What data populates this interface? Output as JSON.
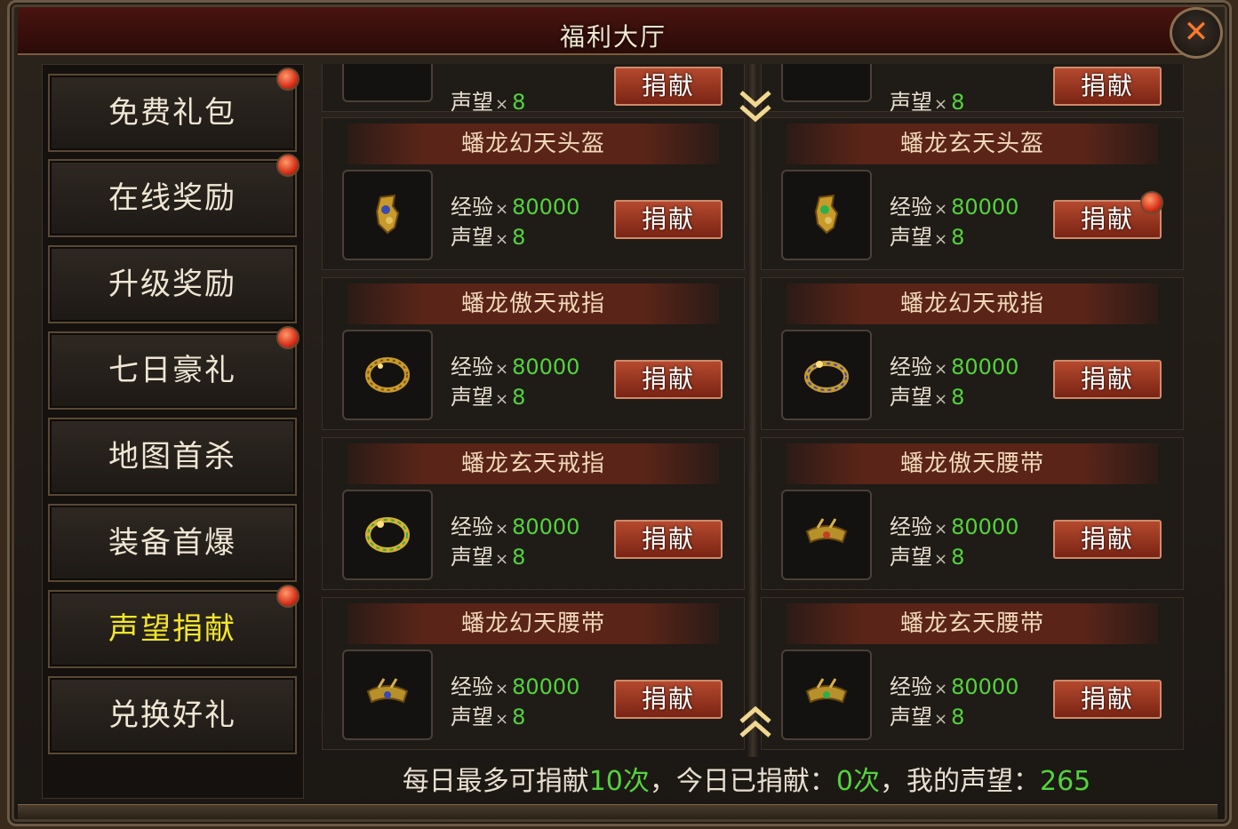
{
  "window": {
    "title": "福利大厅",
    "close_icon": "close-icon",
    "accent_color": "#ff7a2a"
  },
  "sidebar": {
    "items": [
      {
        "label": "免费礼包",
        "badge": true,
        "active": false
      },
      {
        "label": "在线奖励",
        "badge": true,
        "active": false
      },
      {
        "label": "升级奖励",
        "badge": false,
        "active": false
      },
      {
        "label": "七日豪礼",
        "badge": true,
        "active": false
      },
      {
        "label": "地图首杀",
        "badge": false,
        "active": false
      },
      {
        "label": "装备首爆",
        "badge": false,
        "active": false
      },
      {
        "label": "声望捐献",
        "badge": true,
        "active": true
      },
      {
        "label": "兑换好礼",
        "badge": false,
        "active": false
      }
    ]
  },
  "reward_labels": {
    "exp": "经验",
    "reputation": "声望",
    "times": "×",
    "donate_button": "捐献"
  },
  "partial_row": [
    {
      "rep_label": "声望",
      "rep_value": "8",
      "button": "捐献"
    },
    {
      "rep_label": "声望",
      "rep_value": "8",
      "button": "捐献"
    }
  ],
  "items": [
    {
      "name": "蟠龙幻天头盔",
      "exp": "80000",
      "rep": "8",
      "icon": "helmet-icon",
      "badge": false
    },
    {
      "name": "蟠龙玄天头盔",
      "exp": "80000",
      "rep": "8",
      "icon": "helmet-icon",
      "badge": true
    },
    {
      "name": "蟠龙傲天戒指",
      "exp": "80000",
      "rep": "8",
      "icon": "ring-icon",
      "badge": false
    },
    {
      "name": "蟠龙幻天戒指",
      "exp": "80000",
      "rep": "8",
      "icon": "ring-icon",
      "badge": false
    },
    {
      "name": "蟠龙玄天戒指",
      "exp": "80000",
      "rep": "8",
      "icon": "ring-icon",
      "badge": false
    },
    {
      "name": "蟠龙傲天腰带",
      "exp": "80000",
      "rep": "8",
      "icon": "belt-icon",
      "badge": false
    },
    {
      "name": "蟠龙幻天腰带",
      "exp": "80000",
      "rep": "8",
      "icon": "belt-icon",
      "badge": false
    },
    {
      "name": "蟠龙玄天腰带",
      "exp": "80000",
      "rep": "8",
      "icon": "belt-icon",
      "badge": false
    }
  ],
  "footer": {
    "prefix": "每日最多可捐献",
    "max_count": "10次",
    "mid": "，今日已捐献：",
    "today_count": "0次",
    "rep_label": "，我的声望：",
    "reputation": "265"
  },
  "colors": {
    "value_green": "#53d43b",
    "active_tab_yellow": "#f3e62b",
    "button_red": "#9a3420"
  }
}
